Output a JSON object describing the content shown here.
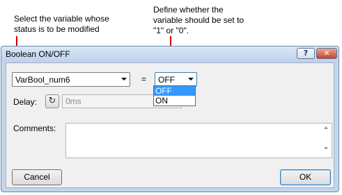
{
  "annotations": {
    "left": "Select the variable whose\nstatus is to be modified",
    "right": "Define whether the\nvariable should be set to\n\"1\" or \"0\"."
  },
  "dialog": {
    "title": "Boolean ON/OFF",
    "help_label": "?",
    "close_label": "✕"
  },
  "variable_select": {
    "value": "VarBool_num6"
  },
  "equals_sign": "=",
  "value_select": {
    "value": "OFF",
    "options": [
      "OFF",
      "ON"
    ]
  },
  "delay": {
    "label": "Delay:",
    "value": "0ms",
    "button_glyph": "↻"
  },
  "comments": {
    "label": "Comments:",
    "value": ""
  },
  "buttons": {
    "cancel": "Cancel",
    "ok": "OK"
  },
  "colors": {
    "arrow": "#d40000",
    "selection": "#3399ff",
    "dialog_frame": "#c4d5ec"
  }
}
